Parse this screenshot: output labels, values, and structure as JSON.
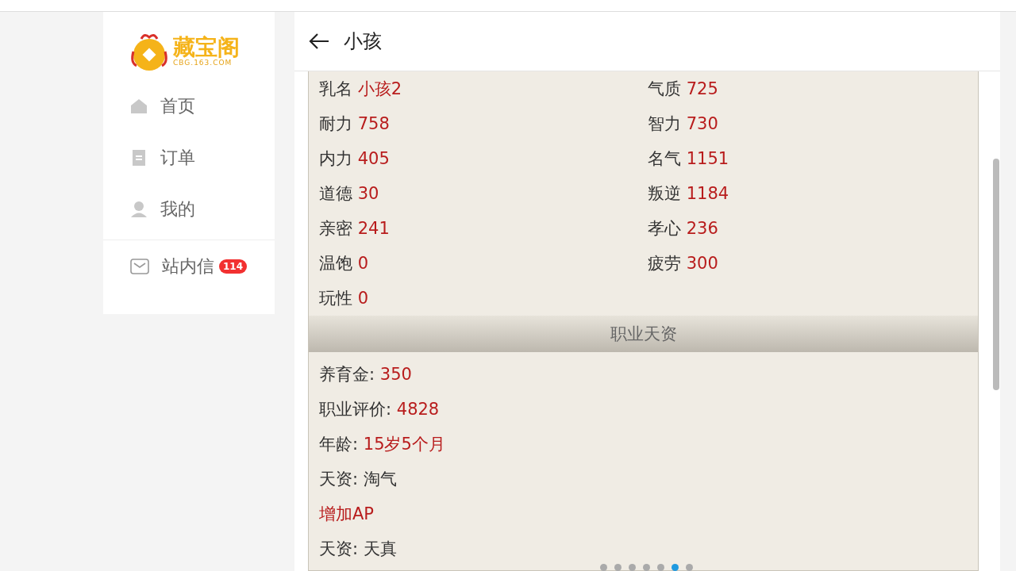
{
  "logo": {
    "name": "藏宝阁",
    "domain": "CBG.163.COM"
  },
  "sidebar": {
    "items": [
      {
        "label": "首页",
        "kind": "home"
      },
      {
        "label": "订单",
        "kind": "order"
      },
      {
        "label": "我的",
        "kind": "user"
      }
    ],
    "footer_items": [
      {
        "label": "站内信",
        "kind": "mail",
        "badge": "114"
      }
    ]
  },
  "header": {
    "title": "小孩"
  },
  "attributes": [
    {
      "label": "乳名",
      "value": "小孩2"
    },
    {
      "label": "气质",
      "value": "725"
    },
    {
      "label": "耐力",
      "value": "758"
    },
    {
      "label": "智力",
      "value": "730"
    },
    {
      "label": "内力",
      "value": "405"
    },
    {
      "label": "名气",
      "value": "1151"
    },
    {
      "label": "道德",
      "value": "30"
    },
    {
      "label": "叛逆",
      "value": "1184"
    },
    {
      "label": "亲密",
      "value": "241"
    },
    {
      "label": "孝心",
      "value": "236"
    },
    {
      "label": "温饱",
      "value": "0"
    },
    {
      "label": "疲劳",
      "value": "300"
    },
    {
      "label": "玩性",
      "value": "0"
    }
  ],
  "section": {
    "title": "职业天资"
  },
  "details": [
    {
      "kind": "stat",
      "label": "养育金:",
      "value": "350"
    },
    {
      "kind": "stat",
      "label": "职业评价:",
      "value": "4828"
    },
    {
      "kind": "stat",
      "label": "年龄:",
      "value": "15岁5个月"
    },
    {
      "kind": "trait",
      "label": "天资:",
      "value": "淘气"
    },
    {
      "kind": "note",
      "label": "增加AP"
    },
    {
      "kind": "trait",
      "label": "天资:",
      "value": "天真"
    }
  ],
  "pager": [
    {
      "selected": false
    },
    {
      "selected": false
    },
    {
      "selected": false
    },
    {
      "selected": false
    },
    {
      "selected": false
    },
    {
      "selected": true
    },
    {
      "selected": false
    }
  ]
}
